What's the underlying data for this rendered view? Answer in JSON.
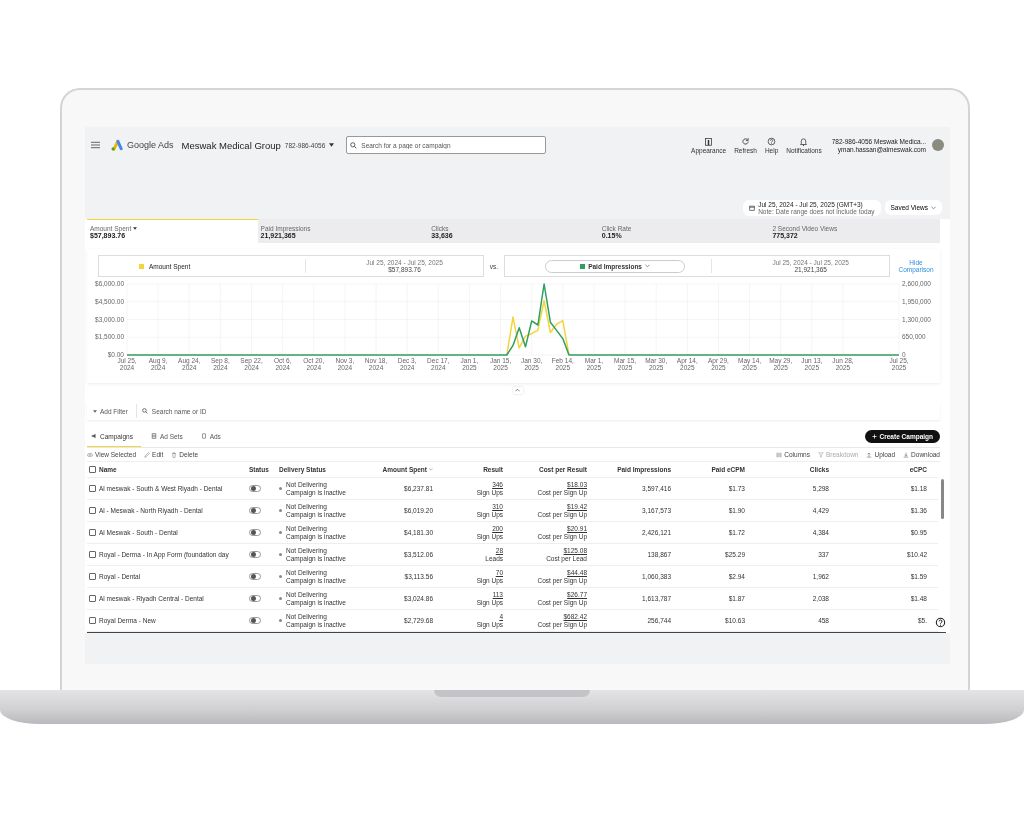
{
  "header": {
    "product": "Google Ads",
    "account": "Meswak Medical Group",
    "account_id": "782-986-4056",
    "search": {
      "placeholder": "Search for a page or campaign"
    },
    "tools": [
      {
        "kind": "appearance",
        "label": "Appearance"
      },
      {
        "kind": "refresh",
        "label": "Refresh"
      },
      {
        "kind": "help",
        "label": "Help"
      },
      {
        "kind": "bell",
        "label": "Notifications"
      }
    ],
    "user": {
      "line1": "782-986-4056 Meswak Medica...",
      "line2": "yman.hassan@almeswak.com"
    }
  },
  "date_range": {
    "label": "Jul 25, 2024 - Jul 25, 2025 (GMT+3)",
    "note": "Note: Date range does not include today"
  },
  "saved_views": "Saved Views",
  "metrics": [
    {
      "label": "Amount Spent",
      "value": "$57,893.76",
      "selected": true
    },
    {
      "label": "Paid Impressions",
      "value": "21,921,365",
      "selected": false
    },
    {
      "label": "Clicks",
      "value": "33,636",
      "selected": false
    },
    {
      "label": "Click Rate",
      "value": "0.15%",
      "selected": false
    },
    {
      "label": "2 Second Video Views",
      "value": "775,372",
      "selected": false
    }
  ],
  "comparison": {
    "left": {
      "range": "Jul 25, 2024 - Jul 25, 2025",
      "value": "$57,893.76"
    },
    "vs": "vs.",
    "right": {
      "range": "Jul 25, 2024 - Jul 25, 2025",
      "value": "21,921,365"
    },
    "hide_link": "Hide Comparison"
  },
  "chart_data": {
    "type": "line",
    "categories": [
      "Jul 25, 2024",
      null,
      null,
      null,
      null,
      "Aug 9, 2024",
      null,
      null,
      null,
      null,
      "Aug 24, 2024",
      null,
      null,
      null,
      null,
      "Sep 8, 2024",
      null,
      null,
      null,
      null,
      "Sep 22, 2024",
      null,
      null,
      null,
      null,
      "Oct 6, 2024",
      null,
      null,
      null,
      null,
      "Oct 20, 2024",
      null,
      null,
      null,
      null,
      "Nov 3, 2024",
      null,
      null,
      null,
      null,
      "Nov 18, 2024",
      null,
      null,
      null,
      null,
      "Dec 3, 2024",
      null,
      null,
      null,
      null,
      "Dec 17, 2024",
      null,
      null,
      null,
      null,
      "Jan 1, 2025",
      null,
      null,
      null,
      null,
      "Jan 15, 2025",
      null,
      null,
      null,
      null,
      "Jan 30, 2025",
      null,
      null,
      null,
      null,
      "Feb 14, 2025",
      null,
      null,
      null,
      null,
      "Mar 1, 2025",
      null,
      null,
      null,
      null,
      "Mar 15, 2025",
      null,
      null,
      null,
      null,
      "Mar 30, 2025",
      null,
      null,
      null,
      null,
      "Apr 14, 2025",
      null,
      null,
      null,
      null,
      "Apr 29, 2025",
      null,
      null,
      null,
      null,
      "May 14, 2025",
      null,
      null,
      null,
      null,
      "May 29, 2025",
      null,
      null,
      null,
      null,
      "Jun 13, 2025",
      null,
      null,
      null,
      null,
      "Jun 28, 2025",
      null,
      null,
      null,
      null,
      null,
      null,
      null,
      null,
      "Jul 25, 2025"
    ],
    "ylim": [
      0,
      6000
    ],
    "yticks": [
      {
        "value": 0,
        "label": "$0.00"
      },
      {
        "value": 1500,
        "label": "$1,500.00"
      },
      {
        "value": 3000,
        "label": "$3,000.00"
      },
      {
        "value": 4500,
        "label": "$4,500.00"
      },
      {
        "value": 6000,
        "label": "$6,000.00"
      }
    ],
    "y2lim": [
      0,
      2600000
    ],
    "y2ticks": [
      {
        "value": 0,
        "label": "0"
      },
      {
        "value": 650000,
        "label": "650,000"
      },
      {
        "value": 1300000,
        "label": "1,300,000"
      },
      {
        "value": 1950000,
        "label": "1,950,000"
      },
      {
        "value": 2600000,
        "label": "2,600,000"
      }
    ],
    "grid": true,
    "series": [
      {
        "name": "Amount Spent",
        "color": "#f2d43b",
        "values": [
          null,
          null,
          null,
          null,
          null,
          null,
          null,
          null,
          null,
          null,
          null,
          null,
          null,
          null,
          null,
          null,
          null,
          null,
          null,
          null,
          null,
          null,
          null,
          null,
          null,
          null,
          null,
          null,
          null,
          null,
          null,
          null,
          null,
          null,
          null,
          null,
          null,
          null,
          null,
          null,
          null,
          null,
          null,
          null,
          null,
          null,
          null,
          null,
          null,
          null,
          null,
          null,
          null,
          null,
          null,
          null,
          null,
          null,
          null,
          null,
          null,
          0,
          3200,
          600,
          1600,
          1800,
          2100,
          4600,
          1900,
          2600,
          2900,
          0,
          null,
          null,
          null,
          null,
          null,
          null,
          null,
          null,
          null,
          null,
          null,
          null,
          null,
          null,
          null,
          null,
          null,
          null,
          null,
          null,
          null,
          null,
          null,
          null,
          null,
          null,
          null,
          null,
          null,
          null,
          null,
          null,
          null,
          null,
          null,
          null,
          null,
          null,
          null,
          null,
          null,
          null,
          null,
          null,
          null,
          null,
          null,
          null,
          null,
          null,
          null,
          null,
          null
        ]
      },
      {
        "name": "Paid Impressions",
        "color": "#2f9e5f",
        "axis": "y2",
        "values": [
          0,
          0,
          0,
          0,
          0,
          0,
          0,
          0,
          0,
          0,
          0,
          0,
          0,
          0,
          0,
          0,
          0,
          0,
          0,
          0,
          0,
          0,
          0,
          0,
          0,
          0,
          0,
          0,
          0,
          0,
          0,
          0,
          0,
          0,
          0,
          0,
          0,
          0,
          0,
          0,
          0,
          0,
          0,
          0,
          0,
          0,
          0,
          0,
          0,
          0,
          0,
          0,
          0,
          0,
          0,
          0,
          0,
          0,
          0,
          0,
          0,
          0,
          350000,
          1000000,
          300000,
          1250000,
          1100000,
          2600000,
          1200000,
          900000,
          600000,
          0,
          0,
          0,
          0,
          0,
          0,
          0,
          0,
          0,
          0,
          0,
          0,
          0,
          0,
          0,
          0,
          0,
          0,
          0,
          0,
          0,
          0,
          0,
          0,
          0,
          0,
          0,
          0,
          0,
          0,
          0,
          0,
          0,
          0,
          0,
          0,
          0,
          0,
          0,
          0,
          0,
          0,
          0,
          0,
          0,
          0,
          0,
          0,
          0,
          0,
          0,
          0,
          0,
          0
        ]
      }
    ]
  },
  "filter": {
    "add_label": "Add Filter",
    "search_placeholder": "Search name or ID"
  },
  "tabs": [
    {
      "label": "Campaigns",
      "kind": "campaigns",
      "selected": true
    },
    {
      "label": "Ad Sets",
      "kind": "adsets",
      "selected": false
    },
    {
      "label": "Ads",
      "kind": "ads",
      "selected": false
    }
  ],
  "create_button": "Create Campaign",
  "actions_left": [
    {
      "kind": "view",
      "label": "View Selected"
    },
    {
      "kind": "edit",
      "label": "Edit"
    },
    {
      "kind": "delete",
      "label": "Delete"
    }
  ],
  "actions_right": [
    {
      "kind": "columns",
      "label": "Columns",
      "disabled": false
    },
    {
      "kind": "breakdown",
      "label": "Breakdown",
      "disabled": true
    },
    {
      "kind": "upload",
      "label": "Upload",
      "disabled": false
    },
    {
      "kind": "download",
      "label": "Download",
      "disabled": false
    }
  ],
  "table": {
    "all_checked": false,
    "columns": [
      {
        "label": "Name",
        "sorted": false
      },
      {
        "label": "Status",
        "sorted": false
      },
      {
        "label": "Delivery Status",
        "sorted": false
      },
      {
        "label": "Amount Spent",
        "sorted": true
      },
      {
        "label": "Result",
        "sorted": false
      },
      {
        "label": "Cost per Result",
        "sorted": false
      },
      {
        "label": "Paid Impressions",
        "sorted": false
      },
      {
        "label": "Paid eCPM",
        "sorted": false
      },
      {
        "label": "Clicks",
        "sorted": false
      },
      {
        "label": "eCPC",
        "sorted": false
      }
    ],
    "rows": [
      {
        "checked": false,
        "name": "Al meswak - South & West Riyadh - Dental",
        "on": false,
        "delivery": "Not Delivering",
        "delivery_note": "Campaign is inactive",
        "amount_spent": "$6,237.81",
        "result": "346",
        "result_unit": "Sign Ups",
        "cost": "$18.03",
        "cost_unit": "Cost per Sign Up",
        "impressions": "3,597,416",
        "ecpm": "$1.73",
        "clicks": "5,298",
        "ecpc": "$1.18"
      },
      {
        "checked": false,
        "name": "Al - Meswak - North Riyadh - Dental",
        "on": false,
        "delivery": "Not Delivering",
        "delivery_note": "Campaign is inactive",
        "amount_spent": "$6,019.20",
        "result": "310",
        "result_unit": "Sign Ups",
        "cost": "$19.42",
        "cost_unit": "Cost per Sign Up",
        "impressions": "3,167,573",
        "ecpm": "$1.90",
        "clicks": "4,429",
        "ecpc": "$1.36"
      },
      {
        "checked": false,
        "name": "Al Meswak - South - Dental",
        "on": false,
        "delivery": "Not Delivering",
        "delivery_note": "Campaign is inactive",
        "amount_spent": "$4,181.30",
        "result": "200",
        "result_unit": "Sign Ups",
        "cost": "$20.91",
        "cost_unit": "Cost per Sign Up",
        "impressions": "2,426,121",
        "ecpm": "$1.72",
        "clicks": "4,384",
        "ecpc": "$0.95"
      },
      {
        "checked": false,
        "name": "Royal - Derma - In App Form (foundation day",
        "on": false,
        "delivery": "Not Delivering",
        "delivery_note": "Campaign is inactive",
        "amount_spent": "$3,512.06",
        "result": "28",
        "result_unit": "Leads",
        "cost": "$125.08",
        "cost_unit": "Cost per Lead",
        "impressions": "138,867",
        "ecpm": "$25.29",
        "clicks": "337",
        "ecpc": "$10.42"
      },
      {
        "checked": false,
        "name": "Royal - Dental",
        "on": false,
        "delivery": "Not Delivering",
        "delivery_note": "Campaign is inactive",
        "amount_spent": "$3,113.56",
        "result": "70",
        "result_unit": "Sign Ups",
        "cost": "$44.48",
        "cost_unit": "Cost per Sign Up",
        "impressions": "1,060,383",
        "ecpm": "$2.94",
        "clicks": "1,962",
        "ecpc": "$1.59"
      },
      {
        "checked": false,
        "name": "Al meswak - Riyadh Central - Dental",
        "on": false,
        "delivery": "Not Delivering",
        "delivery_note": "Campaign is inactive",
        "amount_spent": "$3,024.86",
        "result": "113",
        "result_unit": "Sign Ups",
        "cost": "$26.77",
        "cost_unit": "Cost per Sign Up",
        "impressions": "1,613,787",
        "ecpm": "$1.87",
        "clicks": "2,038",
        "ecpc": "$1.48"
      },
      {
        "checked": false,
        "name": "Royal Derma - New",
        "on": false,
        "delivery": "Not Delivering",
        "delivery_note": "Campaign is inactive",
        "amount_spent": "$2,729.68",
        "result": "4",
        "result_unit": "Sign Ups",
        "cost": "$682.42",
        "cost_unit": "Cost per Sign Up",
        "impressions": "256,744",
        "ecpm": "$10.63",
        "clicks": "458",
        "ecpc": "$5."
      }
    ]
  }
}
